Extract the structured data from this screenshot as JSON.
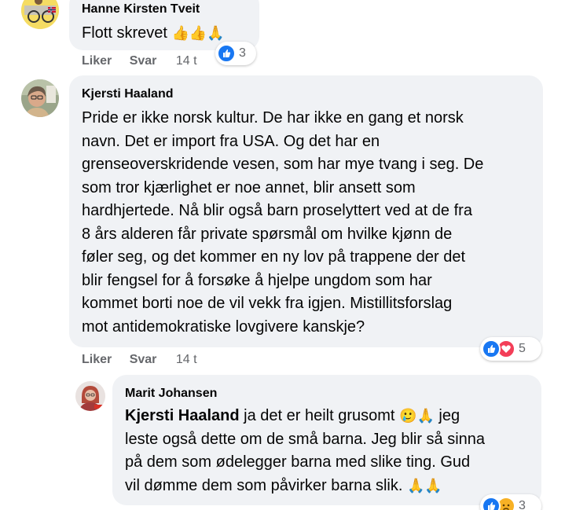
{
  "comments": [
    {
      "author": "Hanne Kirsten Tveit",
      "text": "Flott skrevet",
      "emojis": "👍👍🙏",
      "actions": {
        "like": "Liker",
        "reply": "Svar",
        "time": "14 t"
      },
      "reaction_count": "3",
      "reaction_icons": [
        "like-icon"
      ]
    },
    {
      "author": "Kjersti Haaland",
      "lines": [
        "Pride er ikke norsk kultur. De har ikke en gang et norsk",
        "navn. Det er import fra USA. Og det har en",
        "grenseoverskridende vesen, som har mye tvang i seg. De",
        "som tror kjærlighet er noe annet, blir ansett som",
        "hardhjertede. Nå blir også barn proselyttert ved at de fra",
        "8 års alderen får private spørsmål om hvilke kjønn de",
        "føler seg, og det kommer en ny lov på trappene der det",
        "blir fengsel for å forsøke å hjelpe ungdom som har",
        "kommet borti noe de vil vekk fra igjen. Mistillitsforslag",
        "mot antidemokratiske lovgivere kanskje?"
      ],
      "actions": {
        "like": "Liker",
        "reply": "Svar",
        "time": "14 t"
      },
      "reaction_count": "5",
      "reaction_icons": [
        "like-icon",
        "love-icon"
      ]
    },
    {
      "author": "Marit Johansen",
      "mention": "Kjersti Haaland",
      "line1_rest": " ja det er heilt grusomt ",
      "line1_emojis": "🥲🙏",
      "line1_end": " jeg",
      "lines": [
        "leste også dette om de små barna. Jeg blir så sinna",
        "på dem som ødelegger barna med slike ting. Gud"
      ],
      "last_line": "vil dømme dem som påvirker barna slik. ",
      "last_emojis": "🙏🙏",
      "reaction_count": "3",
      "reaction_icons": [
        "like-icon",
        "sad-icon"
      ]
    }
  ],
  "colors": {
    "bubble": "#f0f2f5",
    "meta": "#65676b",
    "like_blue": "#1877f2",
    "love_red": "#f33e58"
  }
}
